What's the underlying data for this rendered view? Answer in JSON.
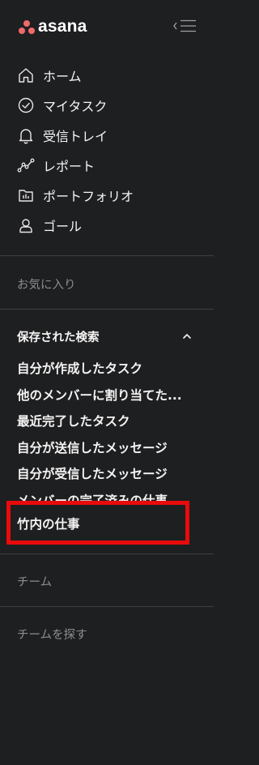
{
  "brand": {
    "name": "asana",
    "logo_color": "#f06a6a"
  },
  "nav": {
    "items": [
      {
        "label": "ホーム",
        "icon": "home-icon"
      },
      {
        "label": "マイタスク",
        "icon": "check-circle-icon"
      },
      {
        "label": "受信トレイ",
        "icon": "bell-icon"
      },
      {
        "label": "レポート",
        "icon": "chart-line-icon"
      },
      {
        "label": "ポートフォリオ",
        "icon": "portfolio-folder-icon"
      },
      {
        "label": "ゴール",
        "icon": "goal-person-icon"
      }
    ]
  },
  "favorites": {
    "title": "お気に入り"
  },
  "saved_searches": {
    "title": "保存された検索",
    "expanded": true,
    "items": [
      {
        "label": "自分が作成したタスク"
      },
      {
        "label": "他のメンバーに割り当てた..."
      },
      {
        "label": "最近完了したタスク"
      },
      {
        "label": "自分が送信したメッセージ"
      },
      {
        "label": "自分が受信したメッセージ"
      },
      {
        "label": "メンバーの完了済みの仕事"
      }
    ],
    "highlighted_item": {
      "label": "竹内の仕事"
    }
  },
  "teams": {
    "title": "チーム"
  },
  "find_teams": {
    "label": "チームを探す"
  },
  "colors": {
    "background": "#1e1f21",
    "text": "#f5f4f3",
    "muted_text": "#8d8d8f",
    "divider": "#3d3e40",
    "highlight_border": "#e90b0b"
  }
}
